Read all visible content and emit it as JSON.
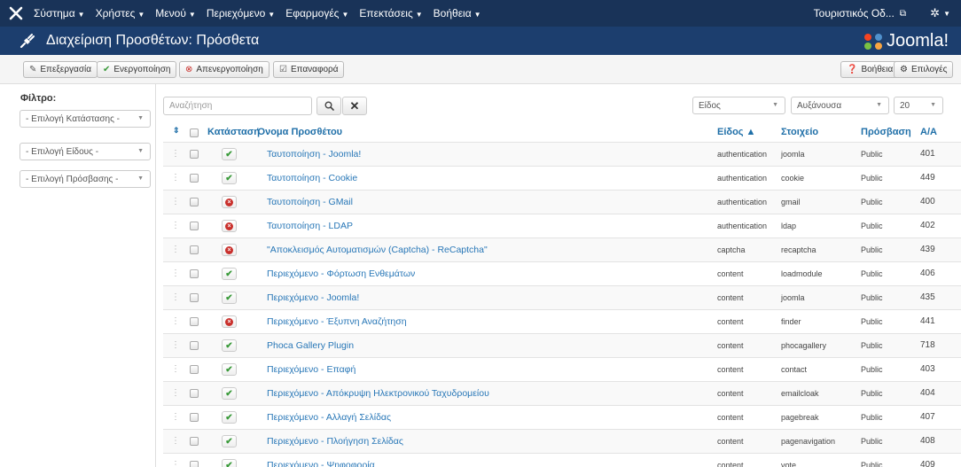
{
  "menubar": {
    "items": [
      {
        "label": "Σύστημα"
      },
      {
        "label": "Χρήστες"
      },
      {
        "label": "Μενού"
      },
      {
        "label": "Περιεχόμενο"
      },
      {
        "label": "Εφαρμογές"
      },
      {
        "label": "Επεκτάσεις"
      },
      {
        "label": "Βοήθεια"
      }
    ],
    "site_name": "Τουριστικός Οδ...",
    "caret_icon": "caret-down-icon",
    "external_icon": "external-link-icon",
    "gear_icon": "gear-icon"
  },
  "header": {
    "title": "Διαχείριση Προσθέτων: Πρόσθετα",
    "icon": "plug-icon",
    "brand": "Joomla!"
  },
  "toolbar": {
    "edit_label": "Επεξεργασία",
    "enable_label": "Ενεργοποίηση",
    "disable_label": "Απενεργοποίηση",
    "checkin_label": "Επαναφορά",
    "help_label": "Βοήθεια",
    "options_label": "Επιλογές"
  },
  "sidebar": {
    "filter_title": "Φίλτρο:",
    "selects": [
      {
        "label": "- Επιλογή Κατάστασης -"
      },
      {
        "label": "- Επιλογή Είδους -"
      },
      {
        "label": "- Επιλογή Πρόσβασης -"
      }
    ]
  },
  "search": {
    "placeholder": "Αναζήτηση",
    "sort_field": "Είδος",
    "sort_direction": "Αυξάνουσα",
    "limit": "20"
  },
  "table": {
    "headers": {
      "status": "Κατάσταση",
      "name": "Όνομα Προσθέτου",
      "type": "Είδος ▲",
      "element": "Στοιχείο",
      "access": "Πρόσβαση",
      "id": "Α/Α"
    },
    "rows": [
      {
        "enabled": true,
        "name": "Ταυτοποίηση - Joomla!",
        "type": "authentication",
        "element": "joomla",
        "access": "Public",
        "id": "401"
      },
      {
        "enabled": true,
        "name": "Ταυτοποίηση - Cookie",
        "type": "authentication",
        "element": "cookie",
        "access": "Public",
        "id": "449"
      },
      {
        "enabled": false,
        "name": "Ταυτοποίηση - GMail",
        "type": "authentication",
        "element": "gmail",
        "access": "Public",
        "id": "400"
      },
      {
        "enabled": false,
        "name": "Ταυτοποίηση - LDAP",
        "type": "authentication",
        "element": "ldap",
        "access": "Public",
        "id": "402"
      },
      {
        "enabled": false,
        "name": "\"Αποκλεισμός Αυτοματισμών (Captcha) - ReCaptcha\"",
        "type": "captcha",
        "element": "recaptcha",
        "access": "Public",
        "id": "439"
      },
      {
        "enabled": true,
        "name": "Περιεχόμενο - Φόρτωση Ενθεμάτων",
        "type": "content",
        "element": "loadmodule",
        "access": "Public",
        "id": "406"
      },
      {
        "enabled": true,
        "name": "Περιεχόμενο - Joomla!",
        "type": "content",
        "element": "joomla",
        "access": "Public",
        "id": "435"
      },
      {
        "enabled": false,
        "name": "Περιεχόμενο - Έξυπνη Αναζήτηση",
        "type": "content",
        "element": "finder",
        "access": "Public",
        "id": "441"
      },
      {
        "enabled": true,
        "name": "Phoca Gallery Plugin",
        "type": "content",
        "element": "phocagallery",
        "access": "Public",
        "id": "718"
      },
      {
        "enabled": true,
        "name": "Περιεχόμενο - Επαφή",
        "type": "content",
        "element": "contact",
        "access": "Public",
        "id": "403"
      },
      {
        "enabled": true,
        "name": "Περιεχόμενο - Απόκρυψη Ηλεκτρονικού Ταχυδρομείου",
        "type": "content",
        "element": "emailcloak",
        "access": "Public",
        "id": "404"
      },
      {
        "enabled": true,
        "name": "Περιεχόμενο - Αλλαγή Σελίδας",
        "type": "content",
        "element": "pagebreak",
        "access": "Public",
        "id": "407"
      },
      {
        "enabled": true,
        "name": "Περιεχόμενο - Πλοήγηση Σελίδας",
        "type": "content",
        "element": "pagenavigation",
        "access": "Public",
        "id": "408"
      },
      {
        "enabled": true,
        "name": "Περιεχόμενο - Ψηφοφορία",
        "type": "content",
        "element": "vote",
        "access": "Public",
        "id": "409"
      }
    ]
  },
  "colors": {
    "menubar": "#193358",
    "header": "#1c3e6e",
    "link": "#2877b7",
    "enabled": "#3a9a3a",
    "disabled": "#c9302c"
  }
}
